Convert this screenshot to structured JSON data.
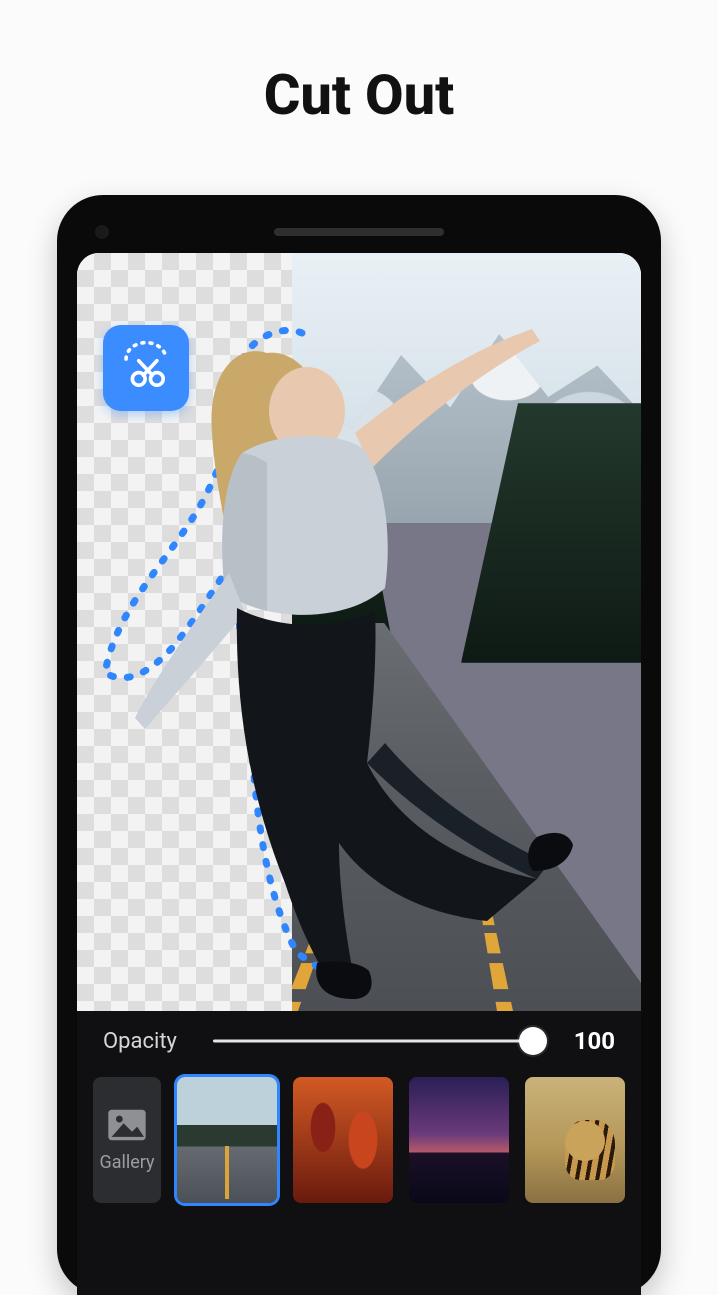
{
  "page": {
    "title": "Cut Out"
  },
  "tool": {
    "name": "cutout-scissors"
  },
  "opacity": {
    "label": "Opacity",
    "value": "100",
    "percent": 100
  },
  "gallery": {
    "label": "Gallery"
  },
  "backgrounds": [
    {
      "id": "road",
      "selected": true
    },
    {
      "id": "canyon",
      "selected": false
    },
    {
      "id": "sunset",
      "selected": false
    },
    {
      "id": "tiger",
      "selected": false
    }
  ]
}
